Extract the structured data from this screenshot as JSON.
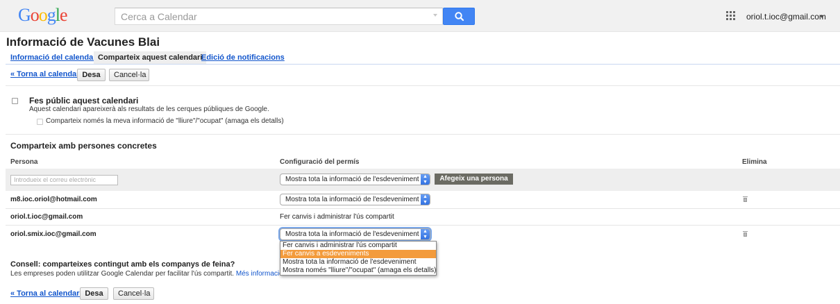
{
  "header": {
    "logo_letters": [
      "G",
      "o",
      "o",
      "g",
      "l",
      "e"
    ],
    "logo_colors": [
      "#4285f4",
      "#ea4335",
      "#fbbc05",
      "#4285f4",
      "#34a853",
      "#ea4335"
    ],
    "search_placeholder": "Cerca a Calendar",
    "search_icon": "search-icon",
    "apps_icon": "apps-grid-icon",
    "user_email": "oriol.t.ioc@gmail.com"
  },
  "page": {
    "title": "Informació de Vacunes Blai",
    "tabs": [
      {
        "label": "Informació del calendari",
        "active": false
      },
      {
        "label": "Comparteix aquest calendari",
        "active": true
      },
      {
        "label": "Edició de notificacions",
        "active": false
      }
    ]
  },
  "toolbar": {
    "back_label": "« Torna al calendari",
    "save_label": "Desa",
    "cancel_label": "Cancel·la"
  },
  "public": {
    "title": "Fes públic aquest calendari",
    "description": "Aquest calendari apareixerà als resultats de les cerques públiques de Google.",
    "free_busy_label": "Comparteix només la meva informació de \"lliure\"/\"ocupat\" (amaga els detalls)",
    "checked": false,
    "free_busy_checked": false
  },
  "sharing": {
    "title": "Comparteix amb persones concretes",
    "col_person": "Persona",
    "col_permission": "Configuració del permís",
    "col_remove": "Elimina",
    "new_person_placeholder": "Introdueix el correu electrònic",
    "new_person_permission": "Mostra tota la informació de l'esdeveniment",
    "add_button": "Afegeix una persona",
    "rows": [
      {
        "email": "m8.ioc.oriol@hotmail.com",
        "permission": "Mostra tota la informació de l'esdeveniment",
        "editable": true,
        "removable": true
      },
      {
        "email": "oriol.t.ioc@gmail.com",
        "permission": "Fer canvis i administrar l'ús compartit",
        "editable": false,
        "removable": false
      },
      {
        "email": "oriol.smix.ioc@gmail.com",
        "permission": "Mostra tota la informació de l'esdeveniment",
        "editable": true,
        "removable": true
      }
    ],
    "dropdown_options": [
      "Fer canvis i administrar l'ús compartit",
      "Fer canvis a esdeveniments",
      "Mostra tota la informació de l'esdeveniment",
      "Mostra només \"lliure\"/\"ocupat\" (amaga els detalls)"
    ],
    "dropdown_highlighted": "Fer canvis a esdeveniments"
  },
  "tip": {
    "title": "Consell: comparteixes contingut amb els companys de feina?",
    "text": "Les empreses poden utilitzar Google Calendar per facilitar l'ús compartit.",
    "more_link": "Més informació"
  },
  "colors": {
    "link": "#1155cc",
    "search_button": "#4285f4",
    "add_button": "#6b6b63",
    "dropdown_highlight": "#f39b3c",
    "band": "#eeeeee"
  }
}
